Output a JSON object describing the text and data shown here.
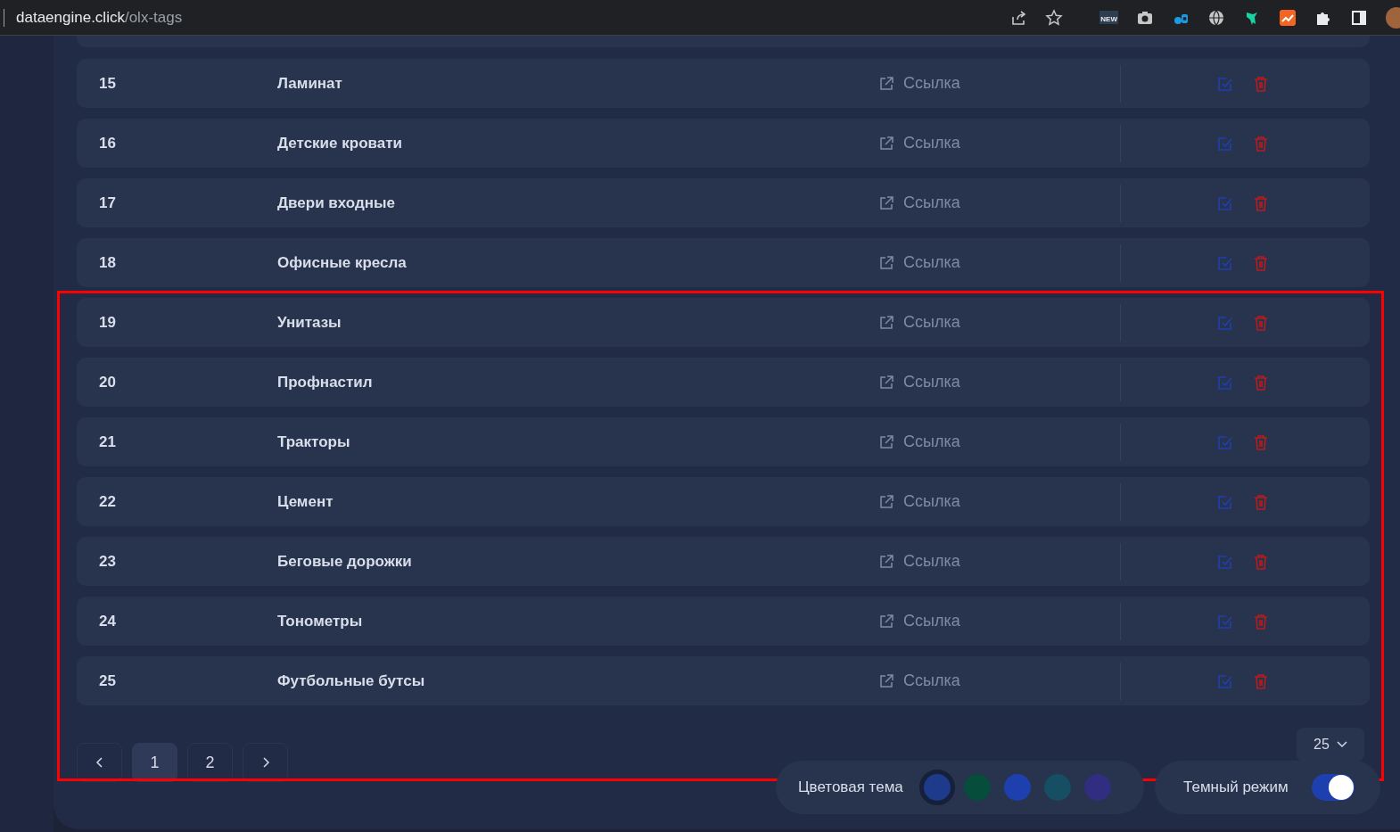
{
  "browser": {
    "url_host": "dataengine.click",
    "url_path": "/olx-tags",
    "extension_badge": "NEW"
  },
  "rows": [
    {
      "number": "15",
      "name": "Ламинат",
      "link": "Ссылка"
    },
    {
      "number": "16",
      "name": "Детские кровати",
      "link": "Ссылка"
    },
    {
      "number": "17",
      "name": "Двери входные",
      "link": "Ссылка"
    },
    {
      "number": "18",
      "name": "Офисные кресла",
      "link": "Ссылка"
    },
    {
      "number": "19",
      "name": "Унитазы",
      "link": "Ссылка"
    },
    {
      "number": "20",
      "name": "Профнастил",
      "link": "Ссылка"
    },
    {
      "number": "21",
      "name": "Тракторы",
      "link": "Ссылка"
    },
    {
      "number": "22",
      "name": "Цемент",
      "link": "Ссылка"
    },
    {
      "number": "23",
      "name": "Беговые дорожки",
      "link": "Ссылка"
    },
    {
      "number": "24",
      "name": "Тонометры",
      "link": "Ссылка"
    },
    {
      "number": "25",
      "name": "Футбольные бутсы",
      "link": "Ссылка"
    }
  ],
  "pagination": {
    "pages": [
      {
        "label": "1",
        "selected": true
      },
      {
        "label": "2",
        "selected": false
      }
    ],
    "per_page": "25"
  },
  "color_theme": {
    "label": "Цветовая тема",
    "swatches": [
      {
        "color": "#1e3a8a",
        "selected": true
      },
      {
        "color": "#064e3b",
        "selected": false
      },
      {
        "color": "#1e40af",
        "selected": false
      },
      {
        "color": "#164e63",
        "selected": false
      },
      {
        "color": "#312e81",
        "selected": false
      }
    ]
  },
  "dark_mode": {
    "label": "Темный режим",
    "on": true
  }
}
